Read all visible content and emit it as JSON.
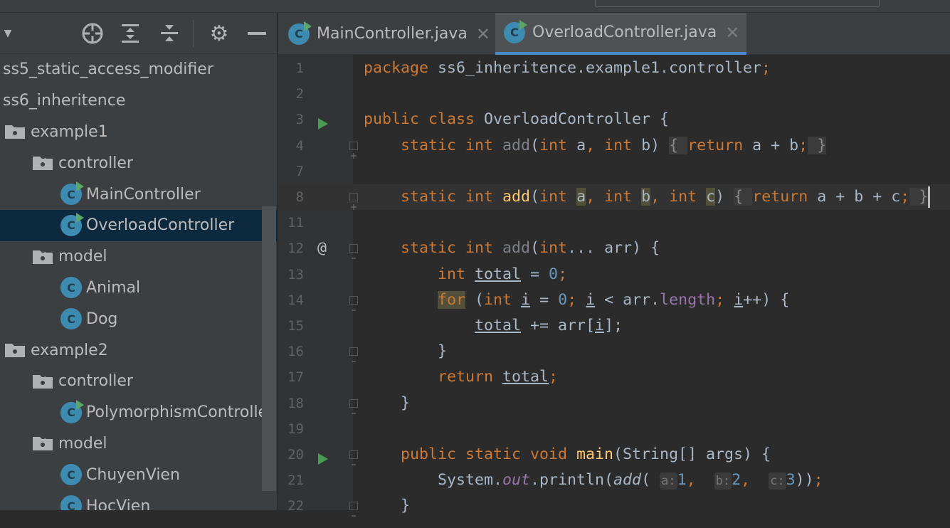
{
  "sidebar": {
    "toolbar_icons": [
      "locate-icon",
      "expand-all-icon",
      "collapse-all-icon",
      "gear-icon",
      "minimize-icon"
    ],
    "tree": [
      {
        "label": "ss5_static_access_modifier",
        "level": 0,
        "type": "text"
      },
      {
        "label": "ss6_inheritence",
        "level": 0,
        "type": "text"
      },
      {
        "label": "example1",
        "level": 0,
        "type": "folder"
      },
      {
        "label": "controller",
        "level": 1,
        "type": "folder",
        "expanded": true
      },
      {
        "label": "MainController",
        "level": 2,
        "type": "class",
        "runnable": true
      },
      {
        "label": "OverloadController",
        "level": 2,
        "type": "class",
        "runnable": true,
        "selected": true
      },
      {
        "label": "model",
        "level": 1,
        "type": "folder",
        "expanded": true
      },
      {
        "label": "Animal",
        "level": 2,
        "type": "class"
      },
      {
        "label": "Dog",
        "level": 2,
        "type": "class"
      },
      {
        "label": "example2",
        "level": 0,
        "type": "folder"
      },
      {
        "label": "controller",
        "level": 1,
        "type": "folder",
        "expanded": true
      },
      {
        "label": "PolymorphismController",
        "level": 2,
        "type": "class",
        "runnable": true
      },
      {
        "label": "model",
        "level": 1,
        "type": "folder",
        "expanded": true
      },
      {
        "label": "ChuyenVien",
        "level": 2,
        "type": "class"
      },
      {
        "label": "HocVien",
        "level": 2,
        "type": "class"
      }
    ]
  },
  "tabs": [
    {
      "label": "MainController.java",
      "active": false
    },
    {
      "label": "OverloadController.java",
      "active": true
    }
  ],
  "editor": {
    "lines": [
      {
        "n": "1",
        "t": [
          [
            "package",
            "k"
          ],
          [
            " ss6_inheritence.example1.controller",
            "p"
          ],
          [
            ";",
            "k"
          ]
        ]
      },
      {
        "n": "2",
        "t": []
      },
      {
        "n": "3",
        "icon": "run",
        "t": [
          [
            "public class ",
            "k"
          ],
          [
            "OverloadController {",
            "p"
          ]
        ]
      },
      {
        "n": "4",
        "fold": "plus",
        "t": [
          [
            "    static int ",
            "k"
          ],
          [
            "add",
            "g"
          ],
          [
            "(",
            "p"
          ],
          [
            "int ",
            "k"
          ],
          [
            "a",
            "p"
          ],
          [
            ",",
            "k"
          ],
          [
            " int ",
            "k"
          ],
          [
            "b) ",
            "p"
          ],
          [
            "{ ",
            "fb"
          ],
          [
            "return ",
            "k"
          ],
          [
            "a + b",
            "p"
          ],
          [
            ";",
            "k"
          ],
          [
            " }",
            "fb"
          ]
        ]
      },
      {
        "n": "7",
        "t": []
      },
      {
        "n": "8",
        "fold": "plus",
        "current": true,
        "t": [
          [
            "    static int ",
            "k"
          ],
          [
            "add",
            "m"
          ],
          [
            "(",
            "p"
          ],
          [
            "int ",
            "k"
          ],
          [
            "a",
            "p h"
          ],
          [
            ",",
            "k"
          ],
          [
            " int ",
            "k"
          ],
          [
            "b",
            "p h"
          ],
          [
            ",",
            "k"
          ],
          [
            " int ",
            "k"
          ],
          [
            "c",
            "p h"
          ],
          [
            ") ",
            "p"
          ],
          [
            "{ ",
            "fb"
          ],
          [
            "return ",
            "k"
          ],
          [
            "a + b + c",
            "p"
          ],
          [
            ";",
            "k"
          ],
          [
            " }",
            "fb"
          ],
          [
            "",
            "caret"
          ]
        ]
      },
      {
        "n": "11",
        "t": []
      },
      {
        "n": "12",
        "icon": "@",
        "fold": "open",
        "t": [
          [
            "    static int ",
            "k"
          ],
          [
            "add",
            "g"
          ],
          [
            "(",
            "p"
          ],
          [
            "int",
            "k"
          ],
          [
            "... arr) {",
            "p"
          ]
        ]
      },
      {
        "n": "13",
        "t": [
          [
            "        int ",
            "k"
          ],
          [
            "total",
            "u"
          ],
          [
            " = ",
            "p"
          ],
          [
            "0",
            "n"
          ],
          [
            ";",
            "k"
          ]
        ]
      },
      {
        "n": "14",
        "fold": "open",
        "t": [
          [
            "        ",
            "p"
          ],
          [
            "for",
            "kh"
          ],
          [
            " (",
            "p"
          ],
          [
            "int ",
            "k"
          ],
          [
            "i",
            "u"
          ],
          [
            " = ",
            "p"
          ],
          [
            "0",
            "n"
          ],
          [
            "; ",
            "k"
          ],
          [
            "i",
            "u"
          ],
          [
            " < arr.",
            "p"
          ],
          [
            "length",
            "fi"
          ],
          [
            "; ",
            "k"
          ],
          [
            "i",
            "u"
          ],
          [
            "++) {",
            "p"
          ]
        ]
      },
      {
        "n": "15",
        "t": [
          [
            "            ",
            "p"
          ],
          [
            "total",
            "u"
          ],
          [
            " += arr[",
            "p"
          ],
          [
            "i",
            "u"
          ],
          [
            "];",
            "p"
          ]
        ]
      },
      {
        "n": "16",
        "fold": "close",
        "t": [
          [
            "        }",
            "p"
          ]
        ]
      },
      {
        "n": "17",
        "t": [
          [
            "        return ",
            "k"
          ],
          [
            "total",
            "u"
          ],
          [
            ";",
            "k"
          ]
        ]
      },
      {
        "n": "18",
        "fold": "close",
        "t": [
          [
            "    }",
            "p"
          ]
        ]
      },
      {
        "n": "19",
        "t": []
      },
      {
        "n": "20",
        "icon": "run",
        "fold": "open",
        "t": [
          [
            "    public static void ",
            "k"
          ],
          [
            "main",
            "m"
          ],
          [
            "(String[] args) {",
            "p"
          ]
        ]
      },
      {
        "n": "21",
        "t": [
          [
            "        System.",
            "p"
          ],
          [
            "out",
            "f"
          ],
          [
            ".println(",
            "p"
          ],
          [
            "add",
            "i"
          ],
          [
            "( ",
            "p"
          ],
          [
            "a:",
            "hint"
          ],
          [
            "1",
            "n"
          ],
          [
            ",  ",
            "k"
          ],
          [
            "b:",
            "hint"
          ],
          [
            "2",
            "n"
          ],
          [
            ",  ",
            "k"
          ],
          [
            "c:",
            "hint"
          ],
          [
            "3",
            "n"
          ],
          [
            "))",
            "p"
          ],
          [
            ";",
            "k"
          ]
        ]
      },
      {
        "n": "22",
        "fold": "close",
        "t": [
          [
            "    }",
            "p"
          ]
        ]
      }
    ]
  }
}
